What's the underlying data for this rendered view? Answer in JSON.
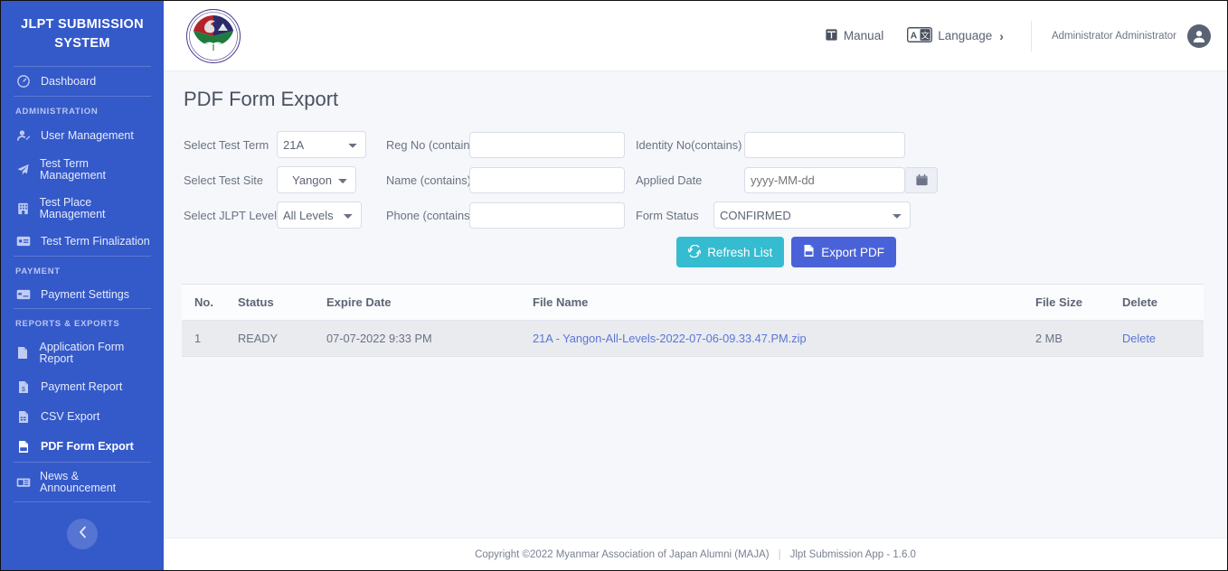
{
  "sidebar": {
    "brand_title": "JLPT SUBMISSION SYSTEM",
    "dashboard": {
      "label": "Dashboard",
      "icon": "dashboard-icon"
    },
    "sections": [
      {
        "title": "ADMINISTRATION",
        "items": [
          {
            "label": "User Management",
            "icon": "user-edit-icon"
          },
          {
            "label": "Test Term Management",
            "icon": "paper-plane-icon"
          },
          {
            "label": "Test Place Management",
            "icon": "building-icon"
          },
          {
            "label": "Test Term Finalization",
            "icon": "id-card-icon"
          }
        ]
      },
      {
        "title": "PAYMENT",
        "items": [
          {
            "label": "Payment Settings",
            "icon": "credit-card-icon"
          }
        ]
      },
      {
        "title": "REPORTS & EXPORTS",
        "items": [
          {
            "label": "Application Form Report",
            "icon": "file-icon"
          },
          {
            "label": "Payment Report",
            "icon": "file-invoice-icon"
          },
          {
            "label": "CSV Export",
            "icon": "file-csv-icon"
          },
          {
            "label": "PDF Form Export",
            "icon": "file-pdf-icon",
            "active": true
          },
          {
            "label": "News & Announcement",
            "icon": "newspaper-icon"
          }
        ]
      }
    ],
    "collapse_button": {
      "icon": "chevron-left-icon"
    },
    "background_color": "#3459c9"
  },
  "header": {
    "logo_alt": "Myanmar Association of Japan Alumni emblem",
    "manual_label": "Manual",
    "manual_icon": "book-icon",
    "language_label": "Language",
    "language_icon": "translate-icon",
    "language_chevron": "›",
    "user_name": "Administrator Administrator",
    "avatar_icon": "user-circle-icon"
  },
  "page": {
    "title": "PDF Form Export"
  },
  "filters": {
    "test_term": {
      "label": "Select Test Term",
      "value": "21A",
      "options": [
        "21A"
      ]
    },
    "reg_no": {
      "label": "Reg No (contains)",
      "value": "",
      "placeholder": ""
    },
    "identity_no": {
      "label": "Identity No(contains)",
      "value": "",
      "placeholder": ""
    },
    "test_site": {
      "label": "Select Test Site",
      "value": "Yangon",
      "options": [
        "Yangon"
      ]
    },
    "name": {
      "label": "Name (contains)",
      "value": "",
      "placeholder": ""
    },
    "applied_date": {
      "label": "Applied Date",
      "value": "",
      "placeholder": "yyyy-MM-dd",
      "icon": "calendar-icon"
    },
    "jlpt_level": {
      "label": "Select JLPT Level",
      "value": "All Levels",
      "options": [
        "All Levels"
      ]
    },
    "phone": {
      "label": "Phone (contains)",
      "value": "",
      "placeholder": ""
    },
    "form_status": {
      "label": "Form Status",
      "value": "CONFIRMED",
      "options": [
        "CONFIRMED"
      ]
    }
  },
  "actions": {
    "refresh": {
      "label": "Refresh List",
      "icon": "refresh-icon",
      "color": "#35bcd0"
    },
    "export": {
      "label": "Export PDF",
      "icon": "file-pdf-icon",
      "color": "#4a62d8"
    }
  },
  "table": {
    "columns": [
      "No.",
      "Status",
      "Expire Date",
      "File Name",
      "File Size",
      "Delete"
    ],
    "rows": [
      {
        "no": "1",
        "status": "READY",
        "expire_date": "07-07-2022 9:33 PM",
        "file_name": "21A - Yangon-All-Levels-2022-07-06-09.33.47.PM.zip",
        "file_size": "2 MB",
        "delete_label": "Delete"
      }
    ]
  },
  "footer": {
    "copyright": "Copyright ©2022 Myanmar Association of Japan Alumni (MAJA)",
    "separator": "|",
    "app_version": "Jlpt Submission App - 1.6.0"
  }
}
